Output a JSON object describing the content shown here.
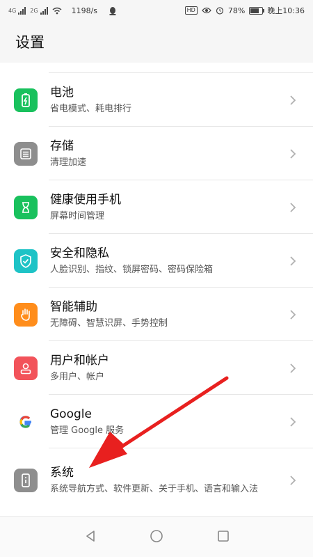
{
  "status": {
    "sig1_label": "4G",
    "sig2_label": "2G",
    "speed": "1198/s",
    "hd": "HD",
    "battery_pct": "78%",
    "time": "晚上10:36",
    "battery_level": 0.78
  },
  "header": {
    "title": "设置"
  },
  "items": [
    {
      "title": "电池",
      "subtitle": "省电模式、耗电排行",
      "icon": "battery-icon",
      "color": "#19c15d"
    },
    {
      "title": "存储",
      "subtitle": "清理加速",
      "icon": "storage-icon",
      "color": "#8e8e8e"
    },
    {
      "title": "健康使用手机",
      "subtitle": "屏幕时间管理",
      "icon": "hourglass-icon",
      "color": "#19c15d"
    },
    {
      "title": "安全和隐私",
      "subtitle": "人脸识别、指纹、锁屏密码、密码保险箱",
      "icon": "shield-check-icon",
      "color": "#1ec3c6"
    },
    {
      "title": "智能辅助",
      "subtitle": "无障碍、智慧识屏、手势控制",
      "icon": "hand-icon",
      "color": "#ff8d1b"
    },
    {
      "title": "用户和帐户",
      "subtitle": "多用户、帐户",
      "icon": "user-icon",
      "color": "#f2535a"
    },
    {
      "title": "Google",
      "subtitle": "管理 Google 服务",
      "icon": "google-icon",
      "color": "#ffffff"
    },
    {
      "title": "系统",
      "subtitle": "系统导航方式、软件更新、关于手机、语言和输入法",
      "icon": "phone-info-icon",
      "color": "#8e8e8e"
    }
  ],
  "nav": {
    "back": "back-icon",
    "home": "home-icon",
    "recents": "recents-icon"
  }
}
